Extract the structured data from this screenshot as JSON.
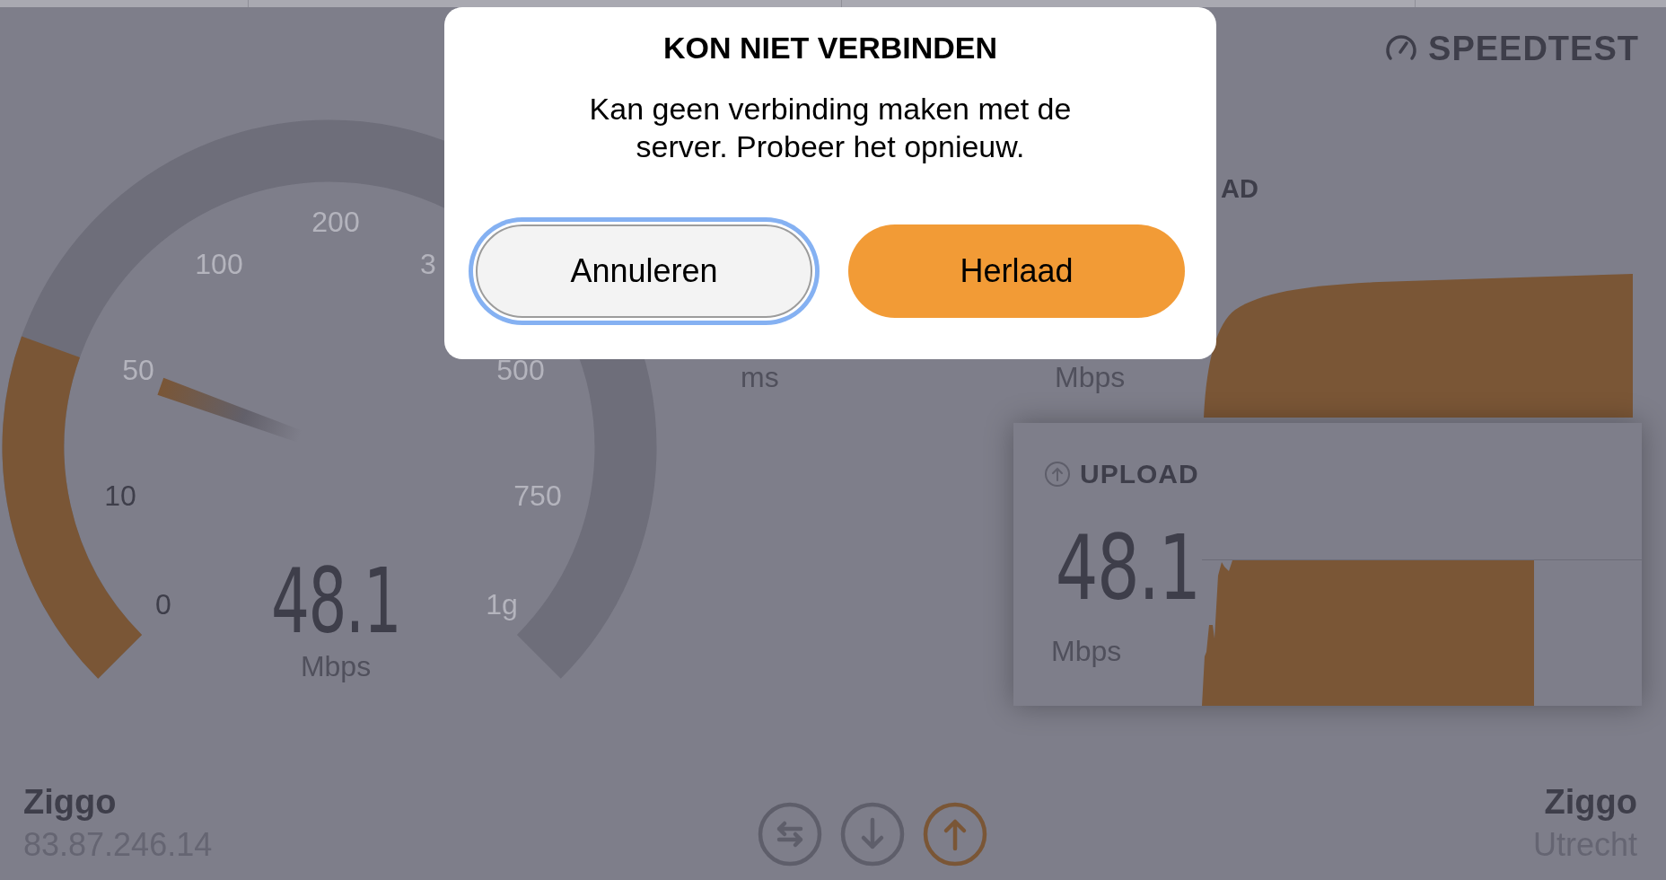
{
  "logo": {
    "text": "SPEEDTEST"
  },
  "gauge": {
    "value": "48.1",
    "unit": "Mbps",
    "ticks": [
      {
        "label": "0",
        "passed": true
      },
      {
        "label": "10",
        "passed": true
      },
      {
        "label": "50",
        "passed": false
      },
      {
        "label": "100",
        "passed": false
      },
      {
        "label": "200",
        "passed": false
      },
      {
        "label": "3",
        "passed": false
      },
      {
        "label": "500",
        "passed": false
      },
      {
        "label": "750",
        "passed": false
      },
      {
        "label": "1g",
        "passed": false
      }
    ]
  },
  "ping": {
    "unit": "ms"
  },
  "download": {
    "title": "AD",
    "unit": "Mbps"
  },
  "upload": {
    "title": "UPLOAD",
    "value": "48.1",
    "unit": "Mbps"
  },
  "isp": {
    "name": "Ziggo",
    "ip": "83.87.246.14"
  },
  "server": {
    "name": "Ziggo",
    "location": "Utrecht"
  },
  "modes": [
    {
      "kind": "both",
      "selected": false
    },
    {
      "kind": "download",
      "selected": false
    },
    {
      "kind": "upload",
      "selected": true
    }
  ],
  "dialog": {
    "title": "KON NIET VERBINDEN",
    "message": "Kan geen verbinding maken met de server. Probeer het opnieuw.",
    "buttons": [
      {
        "label": "Annuleren",
        "kind": "secondary",
        "focused": true
      },
      {
        "label": "Herlaad",
        "kind": "primary",
        "focused": false
      }
    ]
  }
}
